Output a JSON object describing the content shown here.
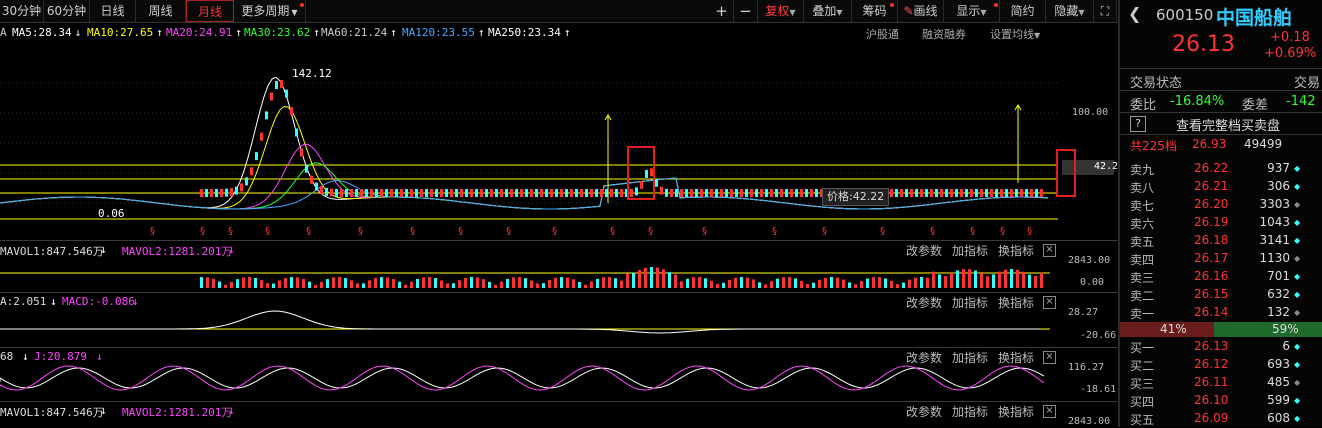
{
  "toolbar": {
    "periods": [
      "30分钟",
      "60分钟",
      "日线",
      "周线",
      "月线",
      "更多周期"
    ],
    "active": "月线",
    "right": [
      "+",
      "−",
      "复权",
      "叠加",
      "筹码",
      "画线",
      "显示",
      "简约",
      "隐藏"
    ]
  },
  "ma_row": {
    "items": [
      {
        "text": "MA5:28.34",
        "color": "#ffffff",
        "arrow": "↓"
      },
      {
        "text": "MA10:27.65",
        "color": "#ffff00",
        "arrow": "↑"
      },
      {
        "text": "MA20:24.91",
        "color": "#ff44ff",
        "arrow": "↑"
      },
      {
        "text": "MA30:23.62",
        "color": "#33ff33",
        "arrow": "↑"
      },
      {
        "text": "MA60:21.24",
        "color": "#cccccc",
        "arrow": "↑"
      },
      {
        "text": "MA120:23.55",
        "color": "#44aaff",
        "arrow": "↑"
      },
      {
        "text": "MA250:23.34",
        "color": "#ffffff",
        "arrow": "↑"
      }
    ],
    "links": [
      "沪股通",
      "融资融券",
      "设置均线"
    ]
  },
  "main_chart": {
    "high_label": "142.12",
    "low_label": "0.06",
    "axis_top": "100.00",
    "price_tag": "42.22",
    "price_tooltip": "价格:42.22"
  },
  "panels": [
    {
      "label_a": "MAVOL1:847.546万",
      "label_b": "MAVOL2:1281.201万",
      "axis_top": "2843.00",
      "axis_bot": "0.00"
    },
    {
      "label_a": "A:2.051",
      "label_b": "MACD:-0.086",
      "axis_top": "28.27",
      "axis_bot": "-20.66"
    },
    {
      "label_a": "68",
      "label_b": "J:20.879",
      "axis_top": "116.27",
      "axis_bot": "-18.61"
    },
    {
      "label_a": "MAVOL1:847.546万",
      "label_b": "MAVOL2:1281.201万",
      "axis_top": "2843.00",
      "axis_bot": ""
    }
  ],
  "panel_buttons": [
    "改参数",
    "加指标",
    "换指标"
  ],
  "quote": {
    "code": "600150",
    "name": "中国船舶",
    "price": "26.13",
    "change": "+0.18",
    "change_pct": "+0.69%",
    "status_label": "交易状态",
    "status_right": "交易",
    "weibi_label": "委比",
    "weibi": "-16.84%",
    "weicha_label": "委差",
    "weicha": "-142",
    "full_book": "查看完整档买卖盘",
    "total_label": "共225档",
    "total_price": "26.93",
    "total_vol": "49499",
    "ratio_left": "41%",
    "ratio_right": "59%"
  },
  "asks": [
    {
      "label": "卖九",
      "price": "26.22",
      "vol": "937"
    },
    {
      "label": "卖八",
      "price": "26.21",
      "vol": "306"
    },
    {
      "label": "卖七",
      "price": "26.20",
      "vol": "3303"
    },
    {
      "label": "卖六",
      "price": "26.19",
      "vol": "1043"
    },
    {
      "label": "卖五",
      "price": "26.18",
      "vol": "3141"
    },
    {
      "label": "卖四",
      "price": "26.17",
      "vol": "1130"
    },
    {
      "label": "卖三",
      "price": "26.16",
      "vol": "701"
    },
    {
      "label": "卖二",
      "price": "26.15",
      "vol": "632"
    },
    {
      "label": "卖一",
      "price": "26.14",
      "vol": "132"
    }
  ],
  "bids": [
    {
      "label": "买一",
      "price": "26.13",
      "vol": "6"
    },
    {
      "label": "买二",
      "price": "26.12",
      "vol": "693"
    },
    {
      "label": "买三",
      "price": "26.11",
      "vol": "485"
    },
    {
      "label": "买四",
      "price": "26.10",
      "vol": "599"
    },
    {
      "label": "买五",
      "price": "26.09",
      "vol": "608"
    }
  ],
  "colors": {
    "up": "#ff3333",
    "down": "#33ffff",
    "accent": "#ffff00"
  }
}
